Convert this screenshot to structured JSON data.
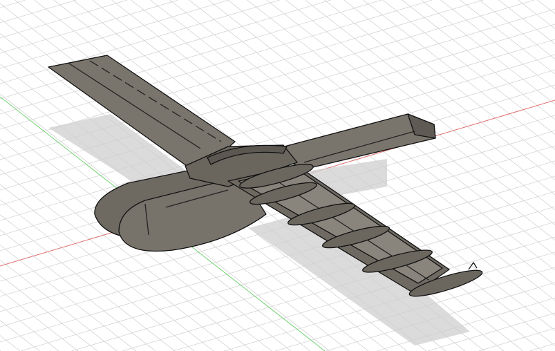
{
  "viewport": {
    "background": "#ffffff",
    "grid_color": "#d4d4d4",
    "x_axis_color": "#e07070",
    "y_axis_color": "#70d070",
    "model_fill": "#6e6a62",
    "model_fill_light": "#817c73",
    "model_edge": "#111111",
    "shadow_color": "#c8c8c8"
  }
}
